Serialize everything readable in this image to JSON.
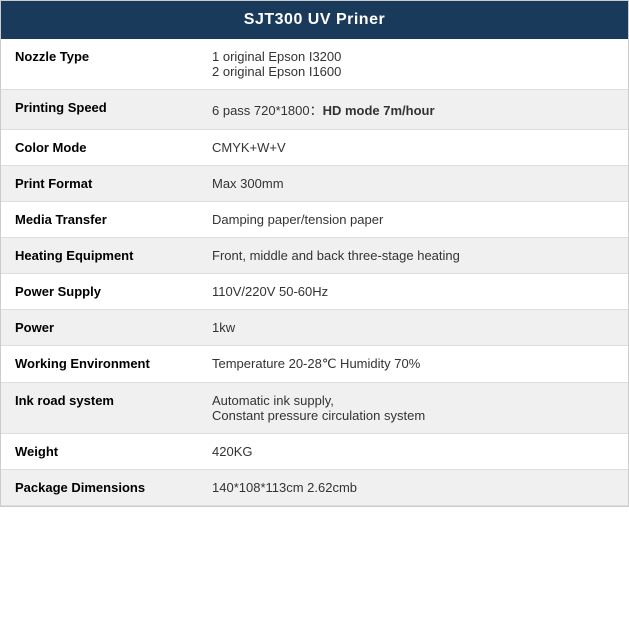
{
  "header": {
    "title": "SJT300 UV Priner"
  },
  "rows": [
    {
      "label": "Nozzle Type",
      "value": "1 original Epson I3200\n2 original Epson I1600",
      "multiline": true,
      "bold_suffix": null
    },
    {
      "label": "Printing Speed",
      "value": "6 pass 720*1800：",
      "bold_suffix": "HD mode 7m/hour",
      "multiline": false
    },
    {
      "label": "Color Mode",
      "value": "CMYK+W+V",
      "multiline": false,
      "bold_suffix": null
    },
    {
      "label": "Print Format",
      "value": "Max 300mm",
      "multiline": false,
      "bold_suffix": null
    },
    {
      "label": "Media Transfer",
      "value": "Damping paper/tension paper",
      "multiline": false,
      "bold_suffix": null
    },
    {
      "label": "Heating Equipment",
      "value": "Front, middle and back three-stage heating",
      "multiline": false,
      "bold_suffix": null
    },
    {
      "label": "Power Supply",
      "value": "110V/220V 50-60Hz",
      "multiline": false,
      "bold_suffix": null
    },
    {
      "label": "Power",
      "value": "1kw",
      "multiline": false,
      "bold_suffix": null
    },
    {
      "label": "Working Environment",
      "value": "Temperature 20-28℃ Humidity 70%",
      "multiline": false,
      "bold_suffix": null
    },
    {
      "label": "Ink road system",
      "value": "Automatic ink supply,\nConstant pressure circulation system",
      "multiline": true,
      "bold_suffix": null
    },
    {
      "label": "Weight",
      "value": "420KG",
      "multiline": false,
      "bold_suffix": null
    },
    {
      "label": "Package Dimensions",
      "value": "140*108*113cm 2.62cmb",
      "multiline": false,
      "bold_suffix": null
    }
  ]
}
